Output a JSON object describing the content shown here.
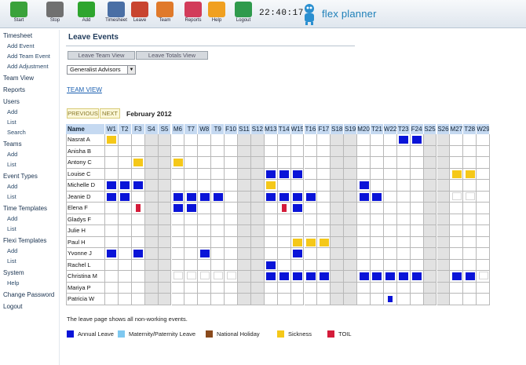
{
  "toolbar": {
    "buttons": [
      {
        "label": "Start",
        "icon": "check-icon",
        "color": "#3aa23a"
      },
      {
        "label": "Stop",
        "icon": "stop-icon",
        "color": "#707070"
      },
      {
        "label": "Add",
        "icon": "add-icon",
        "color": "#2ea52e"
      },
      {
        "label": "Timesheet",
        "icon": "timesheet-icon",
        "color": "#4a6fa5"
      },
      {
        "label": "Leave",
        "icon": "leave-icon",
        "color": "#c8442f"
      },
      {
        "label": "Team",
        "icon": "team-icon",
        "color": "#e07a2a"
      },
      {
        "label": "Reports",
        "icon": "reports-icon",
        "color": "#d23c5a"
      },
      {
        "label": "Help",
        "icon": "help-icon",
        "color": "#f0a020"
      },
      {
        "label": "Logout",
        "icon": "logout-icon",
        "color": "#2f9a4c"
      }
    ],
    "clock": "22:40:17",
    "brand": "flex planner"
  },
  "sidebar": [
    {
      "label": "Timesheet",
      "items": [
        "Add Event",
        "Add Team Event",
        "Add Adjustment"
      ]
    },
    {
      "label": "Team View",
      "items": []
    },
    {
      "label": "Reports",
      "items": []
    },
    {
      "label": "Users",
      "items": [
        "Add",
        "List",
        "Search"
      ]
    },
    {
      "label": "Teams",
      "items": [
        "Add",
        "List"
      ]
    },
    {
      "label": "Event Types",
      "items": [
        "Add",
        "List"
      ]
    },
    {
      "label": "Time Templates",
      "items": [
        "Add",
        "List"
      ]
    },
    {
      "label": "Flexi Templates",
      "items": [
        "Add",
        "List"
      ]
    },
    {
      "label": "System",
      "items": [
        "Help"
      ]
    },
    {
      "label": "Change Password",
      "items": []
    },
    {
      "label": "Logout",
      "items": []
    }
  ],
  "main": {
    "title": "Leave Events",
    "tabs": [
      "Leave Team View",
      "Leave Totals View"
    ],
    "team_select": "Generalist Advisors",
    "team_view_link": "TEAM VIEW",
    "prev_label": "PREVIOUS",
    "next_label": "NEXT",
    "month": "February 2012",
    "footer_note": "The leave page shows all non-working events."
  },
  "grid": {
    "name_header": "Name",
    "days": [
      "W1",
      "T2",
      "F3",
      "S4",
      "S5",
      "M6",
      "T7",
      "W8",
      "T9",
      "F10",
      "S11",
      "S12",
      "M13",
      "T14",
      "W15",
      "T16",
      "F17",
      "S18",
      "S19",
      "M20",
      "T21",
      "W22",
      "T23",
      "F24",
      "S25",
      "S26",
      "M27",
      "T28",
      "W29"
    ],
    "weekend_days": [
      3,
      4,
      10,
      11,
      17,
      18,
      24,
      25
    ],
    "names": [
      "Nasrat A",
      "Anisha B",
      "Antony C",
      "Louise C",
      "Michelle D",
      "Jeanie D",
      "Elena F",
      "Gladys F",
      "Julie H",
      "Paul H",
      "Yvonne J",
      "Rachel L",
      "Christina M",
      "Mariya P",
      "Patricia W"
    ],
    "events": [
      {
        "row": 0,
        "day": 0,
        "type": "sickness"
      },
      {
        "row": 0,
        "day": 22,
        "type": "annual"
      },
      {
        "row": 0,
        "day": 23,
        "type": "annual"
      },
      {
        "row": 2,
        "day": 2,
        "type": "sickness"
      },
      {
        "row": 2,
        "day": 5,
        "type": "sickness"
      },
      {
        "row": 3,
        "day": 12,
        "type": "annual"
      },
      {
        "row": 3,
        "day": 13,
        "type": "annual"
      },
      {
        "row": 3,
        "day": 14,
        "type": "annual"
      },
      {
        "row": 3,
        "day": 26,
        "type": "sickness"
      },
      {
        "row": 3,
        "day": 27,
        "type": "sickness"
      },
      {
        "row": 4,
        "day": 0,
        "type": "annual"
      },
      {
        "row": 4,
        "day": 1,
        "type": "annual"
      },
      {
        "row": 4,
        "day": 2,
        "type": "annual"
      },
      {
        "row": 4,
        "day": 12,
        "type": "sickness"
      },
      {
        "row": 4,
        "day": 19,
        "type": "annual"
      },
      {
        "row": 5,
        "day": 0,
        "type": "annual"
      },
      {
        "row": 5,
        "day": 1,
        "type": "annual"
      },
      {
        "row": 5,
        "day": 5,
        "type": "annual"
      },
      {
        "row": 5,
        "day": 6,
        "type": "annual"
      },
      {
        "row": 5,
        "day": 7,
        "type": "annual"
      },
      {
        "row": 5,
        "day": 8,
        "type": "annual"
      },
      {
        "row": 5,
        "day": 12,
        "type": "annual"
      },
      {
        "row": 5,
        "day": 13,
        "type": "annual"
      },
      {
        "row": 5,
        "day": 14,
        "type": "annual"
      },
      {
        "row": 5,
        "day": 15,
        "type": "annual"
      },
      {
        "row": 5,
        "day": 19,
        "type": "annual"
      },
      {
        "row": 5,
        "day": 20,
        "type": "annual"
      },
      {
        "row": 6,
        "day": 2,
        "type": "toil"
      },
      {
        "row": 6,
        "day": 5,
        "type": "annual"
      },
      {
        "row": 6,
        "day": 6,
        "type": "annual"
      },
      {
        "row": 6,
        "day": 13,
        "type": "toil"
      },
      {
        "row": 6,
        "day": 14,
        "type": "annual"
      },
      {
        "row": 9,
        "day": 14,
        "type": "sickness"
      },
      {
        "row": 9,
        "day": 15,
        "type": "sickness"
      },
      {
        "row": 9,
        "day": 16,
        "type": "sickness"
      },
      {
        "row": 10,
        "day": 0,
        "type": "annual"
      },
      {
        "row": 10,
        "day": 2,
        "type": "annual"
      },
      {
        "row": 10,
        "day": 7,
        "type": "annual"
      },
      {
        "row": 10,
        "day": 14,
        "type": "annual"
      },
      {
        "row": 11,
        "day": 12,
        "type": "annual"
      },
      {
        "row": 12,
        "day": 12,
        "type": "annual"
      },
      {
        "row": 12,
        "day": 13,
        "type": "annual"
      },
      {
        "row": 12,
        "day": 14,
        "type": "annual"
      },
      {
        "row": 12,
        "day": 15,
        "type": "annual"
      },
      {
        "row": 12,
        "day": 16,
        "type": "annual"
      },
      {
        "row": 12,
        "day": 19,
        "type": "annual"
      },
      {
        "row": 12,
        "day": 20,
        "type": "annual"
      },
      {
        "row": 12,
        "day": 21,
        "type": "annual"
      },
      {
        "row": 12,
        "day": 22,
        "type": "annual"
      },
      {
        "row": 12,
        "day": 23,
        "type": "annual"
      },
      {
        "row": 12,
        "day": 26,
        "type": "annual"
      },
      {
        "row": 12,
        "day": 27,
        "type": "annual"
      },
      {
        "row": 14,
        "day": 21,
        "type": "annual_half"
      }
    ],
    "hollow": [
      {
        "row": 5,
        "day": 26
      },
      {
        "row": 5,
        "day": 27
      },
      {
        "row": 12,
        "day": 5
      },
      {
        "row": 12,
        "day": 6
      },
      {
        "row": 12,
        "day": 7
      },
      {
        "row": 12,
        "day": 8
      },
      {
        "row": 12,
        "day": 9
      },
      {
        "row": 12,
        "day": 28
      }
    ]
  },
  "legend": [
    {
      "key": "annual",
      "label": "Annual Leave",
      "color": "#0a14d8"
    },
    {
      "key": "maternity",
      "label": "Maternity/Paternity Leave",
      "color": "#7ec8f0"
    },
    {
      "key": "holiday",
      "label": "National Holiday",
      "color": "#8a4a1c"
    },
    {
      "key": "sickness",
      "label": "Sickness",
      "color": "#f5c819"
    },
    {
      "key": "toil",
      "label": "TOIL",
      "color": "#d41c3a"
    }
  ]
}
